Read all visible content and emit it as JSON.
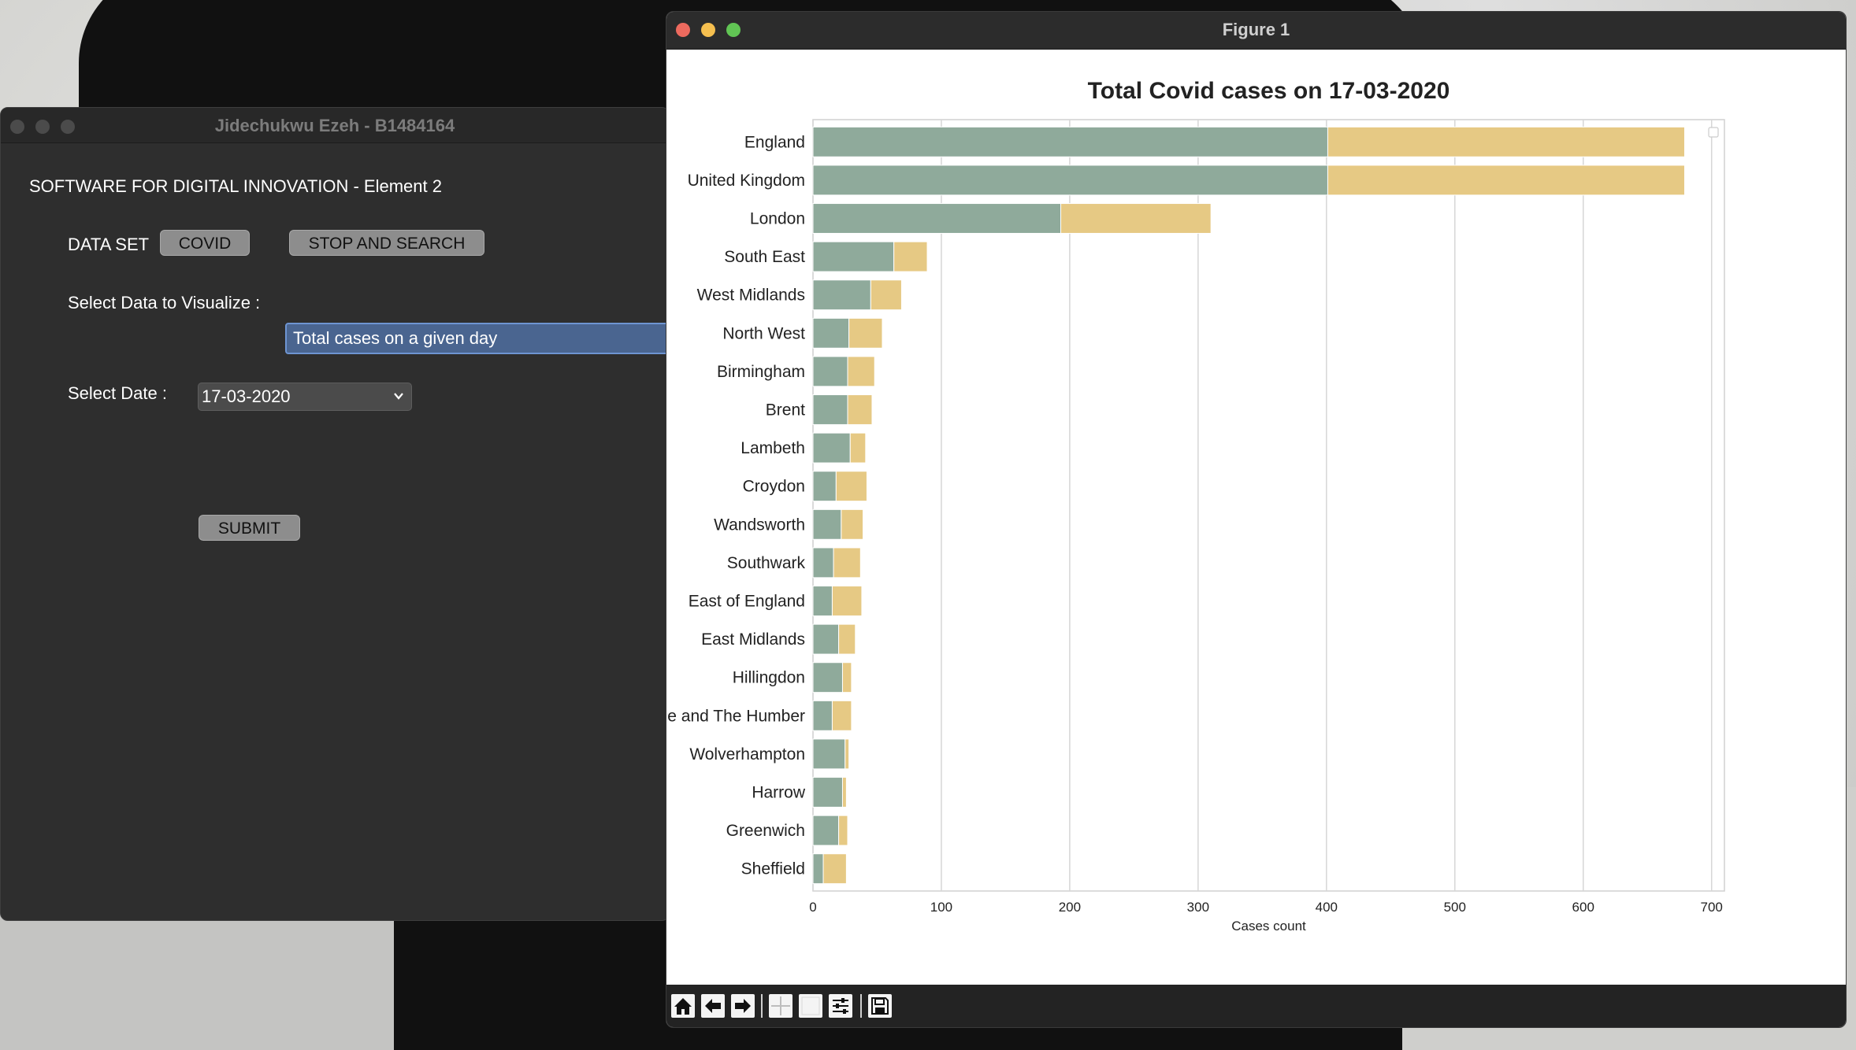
{
  "colors": {
    "bar_series_a": "#8faa9b",
    "bar_series_b": "#e6c984",
    "grid": "#d6d6d6",
    "window_bg": "#2e2e2e",
    "figure_bg": "#ffffff"
  },
  "tk_app": {
    "window_title": "Jidechukwu Ezeh - B1484164",
    "heading": "SOFTWARE FOR DIGITAL INNOVATION - Element 2",
    "dataset_label": "DATA SET",
    "dataset_buttons": [
      "COVID",
      "STOP AND SEARCH"
    ],
    "visualize_label": "Select Data to Visualize :",
    "visualize_value": "Total cases on a given day",
    "date_label": "Select Date :",
    "date_value": "17-03-2020",
    "submit_label": "SUBMIT"
  },
  "figure": {
    "window_title": "Figure 1",
    "toolbar_icons": [
      "home-icon",
      "back-arrow-icon",
      "forward-arrow-icon",
      "pan-icon",
      "zoom-icon",
      "configure-subplots-icon",
      "save-icon"
    ]
  },
  "chart_data": {
    "type": "bar",
    "orientation": "horizontal",
    "stacked": true,
    "title": "Total Covid cases on 17-03-2020",
    "xlabel": "Cases count",
    "ylabel": "",
    "xlim": [
      0,
      710
    ],
    "xticks": [
      0,
      100,
      200,
      300,
      400,
      500,
      600,
      700
    ],
    "grid": "vertical",
    "legend": "top-right (empty)",
    "categories": [
      "England",
      "United Kingdom",
      "London",
      "South East",
      "West Midlands",
      "North West",
      "Birmingham",
      "Brent",
      "Lambeth",
      "Croydon",
      "Wandsworth",
      "Southwark",
      "East of England",
      "East Midlands",
      "Hillingdon",
      "Yorkshire and The Humber",
      "Wolverhampton",
      "Harrow",
      "Greenwich",
      "Sheffield"
    ],
    "category_labels": [
      "England",
      "United Kingdom",
      "London",
      "South East",
      "West Midlands",
      "North West",
      "Birmingham",
      "Brent",
      "Lambeth",
      "Croydon",
      "Wandsworth",
      "Southwark",
      "East of England",
      "East Midlands",
      "Hillingdon",
      "e and The Humber",
      "Wolverhampton",
      "Harrow",
      "Greenwich",
      "Sheffield"
    ],
    "series": [
      {
        "values": [
          401,
          401,
          193,
          63,
          45,
          28,
          27,
          27,
          29,
          18,
          22,
          16,
          15,
          20,
          23,
          15,
          25,
          23,
          20,
          8
        ]
      },
      {
        "values": [
          278,
          278,
          117,
          26,
          24,
          26,
          21,
          19,
          12,
          24,
          17,
          21,
          23,
          13,
          7,
          15,
          3,
          3,
          7,
          18
        ]
      }
    ]
  }
}
